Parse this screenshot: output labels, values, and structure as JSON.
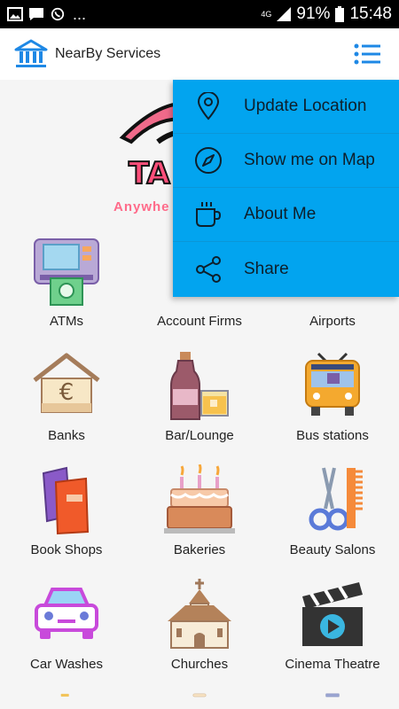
{
  "status_bar": {
    "network": "4G",
    "battery": "91%",
    "time": "15:48",
    "dots": "..."
  },
  "app_bar": {
    "title": "NearBy Services"
  },
  "banner": {
    "logo_text": "TA",
    "tagline": "Anywhe"
  },
  "menu": {
    "items": [
      {
        "label": "Update Location",
        "icon": "location-pin-icon"
      },
      {
        "label": "Show me on Map",
        "icon": "compass-icon"
      },
      {
        "label": "About Me",
        "icon": "coffee-cup-icon"
      },
      {
        "label": "Share",
        "icon": "share-icon"
      }
    ]
  },
  "services": [
    {
      "label": "ATMs",
      "icon": "atm-icon"
    },
    {
      "label": "Account Firms",
      "icon": "account-firm-icon"
    },
    {
      "label": "Airports",
      "icon": "airport-icon"
    },
    {
      "label": "Banks",
      "icon": "bank-icon"
    },
    {
      "label": "Bar/Lounge",
      "icon": "bar-lounge-icon"
    },
    {
      "label": "Bus stations",
      "icon": "bus-icon"
    },
    {
      "label": "Book Shops",
      "icon": "books-icon"
    },
    {
      "label": "Bakeries",
      "icon": "cake-icon"
    },
    {
      "label": "Beauty Salons",
      "icon": "scissors-comb-icon"
    },
    {
      "label": "Car Washes",
      "icon": "car-icon"
    },
    {
      "label": "Churches",
      "icon": "church-icon"
    },
    {
      "label": "Cinema Theatre",
      "icon": "clapperboard-icon"
    }
  ],
  "colors": {
    "menu_bg": "#02a4ef",
    "app_bar_accent": "#1e88e5",
    "banner_pink": "#ff4f7a"
  }
}
